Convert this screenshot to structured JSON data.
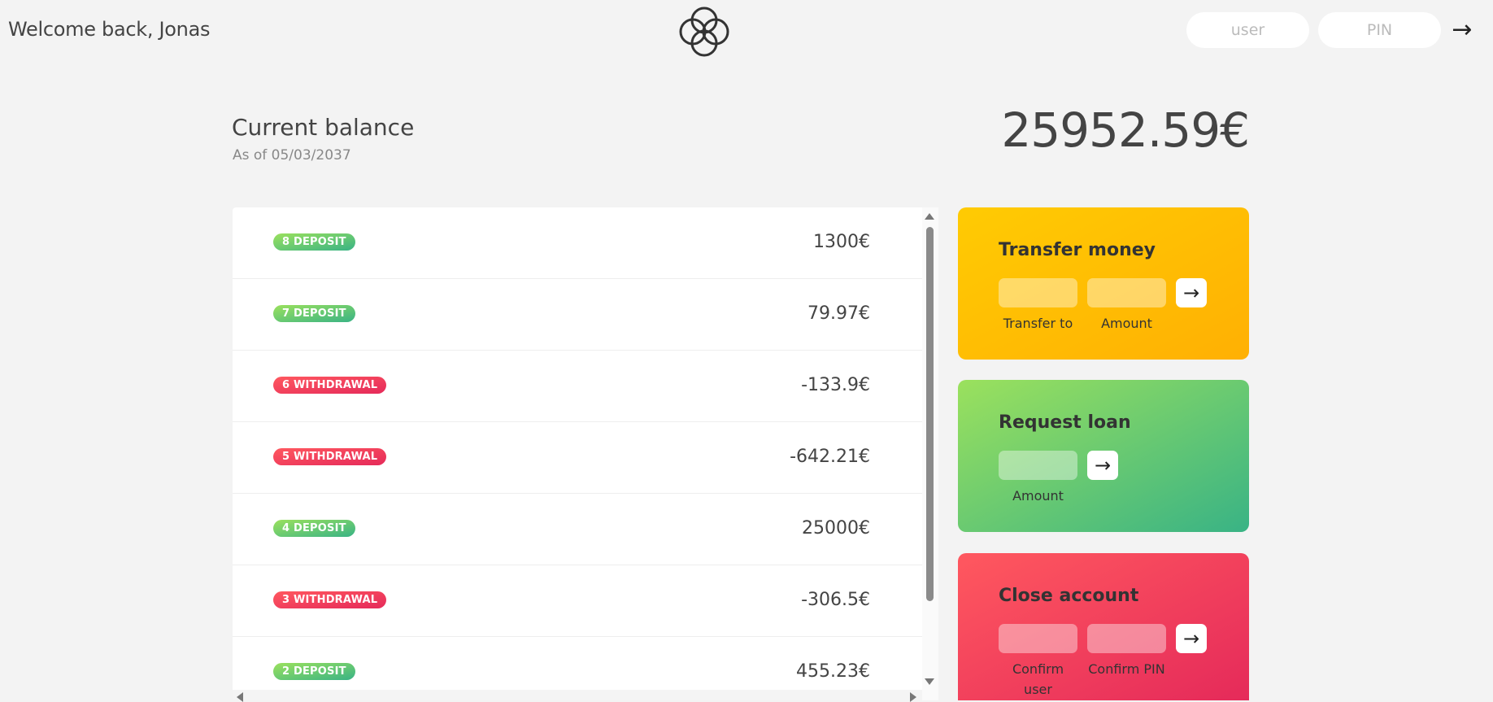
{
  "nav": {
    "welcome": "Welcome back, Jonas",
    "logo": "four-circles-logo-icon",
    "user_placeholder": "user",
    "pin_placeholder": "PIN",
    "login_arrow": "→"
  },
  "balance": {
    "label": "Current balance",
    "date": "As of 05/03/2037",
    "value": "25952.59€"
  },
  "movements": [
    {
      "type_label": "8 deposit",
      "kind": "deposit",
      "value": "1300€"
    },
    {
      "type_label": "7 deposit",
      "kind": "deposit",
      "value": "79.97€"
    },
    {
      "type_label": "6 withdrawal",
      "kind": "withdrawal",
      "value": "-133.9€"
    },
    {
      "type_label": "5 withdrawal",
      "kind": "withdrawal",
      "value": "-642.21€"
    },
    {
      "type_label": "4 deposit",
      "kind": "deposit",
      "value": "25000€"
    },
    {
      "type_label": "3 withdrawal",
      "kind": "withdrawal",
      "value": "-306.5€"
    },
    {
      "type_label": "2 deposit",
      "kind": "deposit",
      "value": "455.23€"
    }
  ],
  "operations": {
    "transfer": {
      "title": "Transfer money",
      "to_label": "Transfer to",
      "amount_label": "Amount",
      "button": "→"
    },
    "loan": {
      "title": "Request loan",
      "amount_label": "Amount",
      "button": "→"
    },
    "close": {
      "title": "Close account",
      "user_label": "Confirm user",
      "pin_label": "Confirm PIN",
      "button": "→"
    }
  },
  "colors": {
    "background": "#f3f3f3",
    "deposit": "#39b385",
    "withdrawal": "#e52a5a",
    "transfer": "#ffb003",
    "loan": "#9be15d",
    "close": "#ff585f"
  }
}
